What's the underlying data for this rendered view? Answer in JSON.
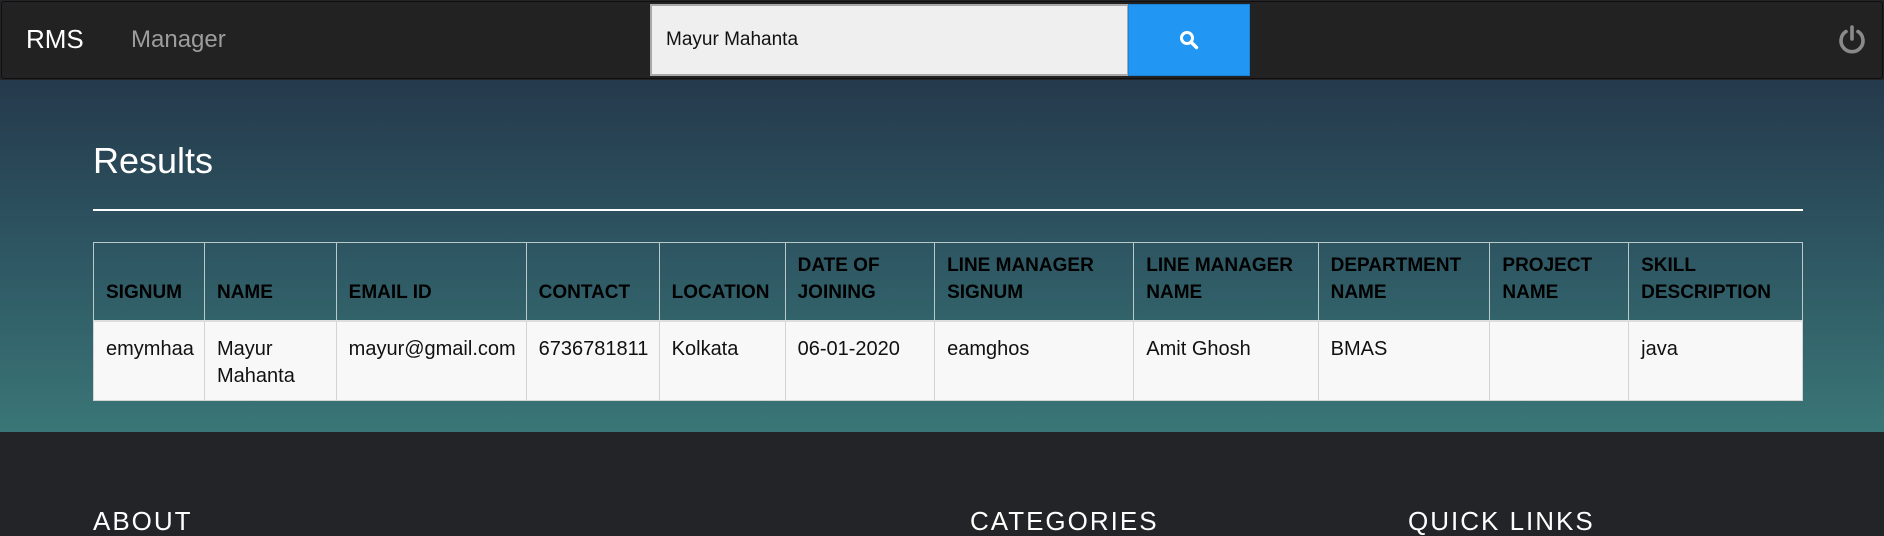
{
  "navbar": {
    "brand": "RMS",
    "nav_link": "Manager",
    "search": {
      "value": "Mayur Mahanta",
      "placeholder": ""
    },
    "search_icon": "search-icon",
    "power_icon": "power-icon"
  },
  "results": {
    "title": "Results",
    "columns": [
      "SIGNUM",
      "NAME",
      "EMAIL ID",
      "CONTACT",
      "LOCATION",
      "DATE OF JOINING",
      "LINE MANAGER SIGNUM",
      "LINE MANAGER NAME",
      "DEPARTMENT NAME",
      "PROJECT NAME",
      "SKILL DESCRIPTION"
    ],
    "rows": [
      [
        "emymhaa",
        "Mayur Mahanta",
        "mayur@gmail.com",
        "6736781811",
        "Kolkata",
        "06-01-2020",
        "eamghos",
        "Amit Ghosh",
        "BMAS",
        "",
        "java"
      ]
    ]
  },
  "footer": {
    "about": "ABOUT",
    "categories": "CATEGORIES",
    "quick_links": "QUICK LINKS"
  },
  "colors": {
    "navbar_bg": "#222222",
    "search_button": "#2196f3",
    "hero_gradient_top": "#253a4c",
    "hero_gradient_bottom": "#3a7677",
    "footer_bg": "#232427"
  }
}
